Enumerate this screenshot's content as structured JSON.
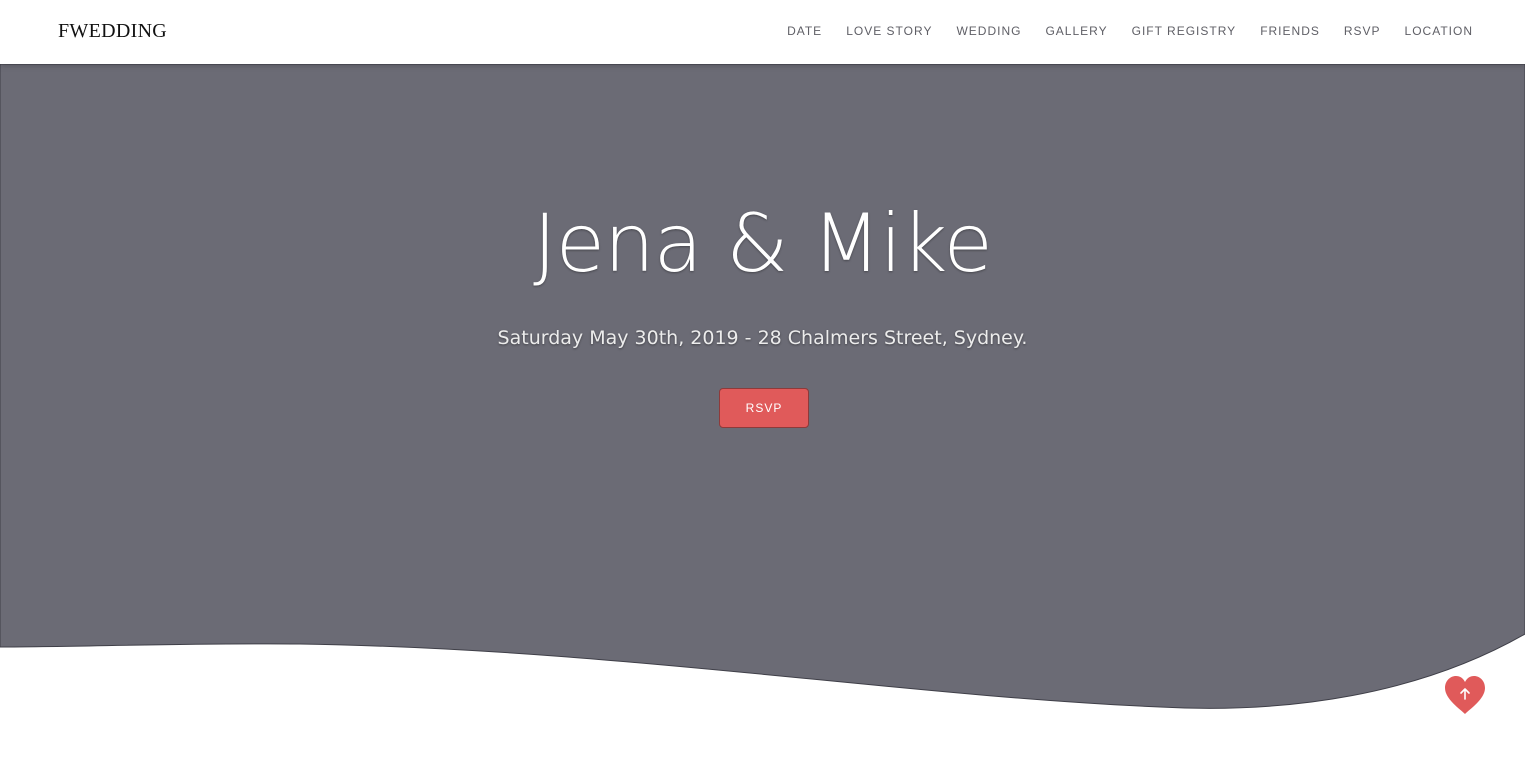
{
  "navbar": {
    "brand": "FWEDDING",
    "links": [
      "DATE",
      "LOVE STORY",
      "WEDDING",
      "GALLERY",
      "GIFT REGISTRY",
      "FRIENDS",
      "RSVP",
      "LOCATION"
    ]
  },
  "hero": {
    "title": "Jena & Mike",
    "subtitle": "Saturday May 30th, 2019 - 28 Chalmers Street, Sydney.",
    "button_label": "RSVP",
    "background_color": "#6b6b75"
  },
  "colors": {
    "accent": "#e05a5a"
  },
  "scroll_top": {
    "icon": "heart-arrow-up-icon"
  }
}
